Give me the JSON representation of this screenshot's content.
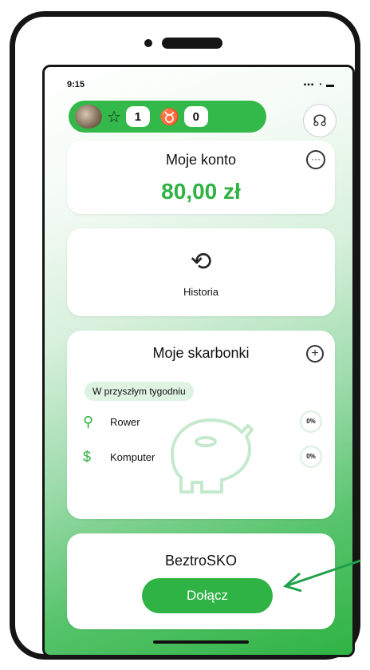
{
  "status_bar": {
    "time": "9:15",
    "indicators": "▪▪▪ ◔ ▬"
  },
  "top_bar": {
    "stars": "1",
    "trophies": "0",
    "star_icon": "star-icon",
    "trophy_icon": "trophy-icon",
    "profile_icon": "profile-icon"
  },
  "account": {
    "title": "Moje konto",
    "amount": "80,00 zł"
  },
  "history": {
    "label": "Historia"
  },
  "piggy": {
    "title": "Moje skarbonki",
    "week": "W przyszłym tygodniu",
    "items": [
      {
        "label": "Rower",
        "percent": "0%",
        "icon": "bicycle-icon"
      },
      {
        "label": "Komputer",
        "percent": "0%",
        "icon": "money-icon"
      }
    ]
  },
  "bez": {
    "title": "BeztroSKO",
    "join": "Dołącz"
  },
  "colors": {
    "accent": "#2fb344"
  }
}
